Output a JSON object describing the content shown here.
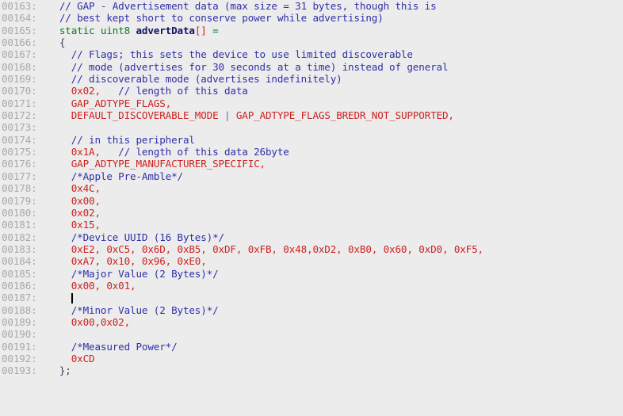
{
  "editor": {
    "name": "source-code-view",
    "language": "C",
    "background_color": "#ECECEC",
    "gutter_text_color": "#A9A9AD",
    "colors": {
      "comment": "#2F2FA8",
      "keyword": "#0A7A22",
      "identifier": "#13135E",
      "number": "#CC2222",
      "macro": "#CC2222",
      "punctuation": "#3A3A5A",
      "operator": "#0A7A22",
      "caret": "#000000"
    },
    "caret_line": "00187",
    "first_line": "00163",
    "last_line": "00193"
  },
  "lines": [
    {
      "no": "00163",
      "tokens": [
        {
          "c": "cmt",
          "t": "  // GAP - Advertisement data (max size = 31 bytes, though this is"
        }
      ]
    },
    {
      "no": "00164",
      "tokens": [
        {
          "c": "cmt",
          "t": "  // best kept short to conserve power while advertising)"
        }
      ]
    },
    {
      "no": "00165",
      "tokens": [
        {
          "c": "plain",
          "t": "  "
        },
        {
          "c": "kw",
          "t": "static uint8"
        },
        {
          "c": "plain",
          "t": " "
        },
        {
          "c": "id",
          "t": "advertData"
        },
        {
          "c": "num",
          "t": "[]"
        },
        {
          "c": "plain",
          "t": " "
        },
        {
          "c": "op",
          "t": "="
        }
      ]
    },
    {
      "no": "00166",
      "tokens": [
        {
          "c": "pun",
          "t": "  {"
        }
      ]
    },
    {
      "no": "00167",
      "tokens": [
        {
          "c": "cmt",
          "t": "    // Flags; this sets the device to use limited discoverable"
        }
      ]
    },
    {
      "no": "00168",
      "tokens": [
        {
          "c": "cmt",
          "t": "    // mode (advertises for 30 seconds at a time) instead of general"
        }
      ]
    },
    {
      "no": "00169",
      "tokens": [
        {
          "c": "cmt",
          "t": "    // discoverable mode (advertises indefinitely)"
        }
      ]
    },
    {
      "no": "00170",
      "tokens": [
        {
          "c": "num",
          "t": "    0x02,"
        },
        {
          "c": "cmt",
          "t": "   // length of this data"
        }
      ]
    },
    {
      "no": "00171",
      "tokens": [
        {
          "c": "mac",
          "t": "    GAP_ADTYPE_FLAGS,"
        }
      ]
    },
    {
      "no": "00172",
      "tokens": [
        {
          "c": "mac",
          "t": "    DEFAULT_DISCOVERABLE_MODE"
        },
        {
          "c": "plain",
          "t": " "
        },
        {
          "c": "pipe",
          "t": "|"
        },
        {
          "c": "plain",
          "t": " "
        },
        {
          "c": "mac",
          "t": "GAP_ADTYPE_FLAGS_BREDR_NOT_SUPPORTED,"
        }
      ]
    },
    {
      "no": "00173",
      "tokens": []
    },
    {
      "no": "00174",
      "tokens": [
        {
          "c": "cmt",
          "t": "    // in this peripheral"
        }
      ]
    },
    {
      "no": "00175",
      "tokens": [
        {
          "c": "num",
          "t": "    0x1A,"
        },
        {
          "c": "cmt",
          "t": "   // length of this data 26byte"
        }
      ]
    },
    {
      "no": "00176",
      "tokens": [
        {
          "c": "mac",
          "t": "    GAP_ADTYPE_MANUFACTURER_SPECIFIC,"
        }
      ]
    },
    {
      "no": "00177",
      "tokens": [
        {
          "c": "cmt",
          "t": "    /*Apple Pre-Amble*/"
        }
      ]
    },
    {
      "no": "00178",
      "tokens": [
        {
          "c": "num",
          "t": "    0x4C,"
        }
      ]
    },
    {
      "no": "00179",
      "tokens": [
        {
          "c": "num",
          "t": "    0x00,"
        }
      ]
    },
    {
      "no": "00180",
      "tokens": [
        {
          "c": "num",
          "t": "    0x02,"
        }
      ]
    },
    {
      "no": "00181",
      "tokens": [
        {
          "c": "num",
          "t": "    0x15,"
        }
      ]
    },
    {
      "no": "00182",
      "tokens": [
        {
          "c": "cmt",
          "t": "    /*Device UUID (16 Bytes)*/"
        }
      ]
    },
    {
      "no": "00183",
      "tokens": [
        {
          "c": "num",
          "t": "    0xE2, 0xC5, 0x6D, 0xB5, 0xDF, 0xFB, 0x48,0xD2, 0xB0, 0x60, 0xD0, 0xF5,"
        }
      ]
    },
    {
      "no": "00184",
      "tokens": [
        {
          "c": "num",
          "t": "    0xA7, 0x10, 0x96, 0xE0,"
        }
      ]
    },
    {
      "no": "00185",
      "tokens": [
        {
          "c": "cmt",
          "t": "    /*Major Value (2 Bytes)*/"
        }
      ]
    },
    {
      "no": "00186",
      "tokens": [
        {
          "c": "num",
          "t": "    0x00, 0x01,"
        }
      ]
    },
    {
      "no": "00187",
      "caret_after": 4,
      "tokens": [
        {
          "c": "plain",
          "t": "    "
        }
      ]
    },
    {
      "no": "00188",
      "tokens": [
        {
          "c": "cmt",
          "t": "    /*Minor Value (2 Bytes)*/"
        }
      ]
    },
    {
      "no": "00189",
      "tokens": [
        {
          "c": "num",
          "t": "    0x00,0x02,"
        }
      ]
    },
    {
      "no": "00190",
      "tokens": []
    },
    {
      "no": "00191",
      "tokens": [
        {
          "c": "cmt",
          "t": "    /*Measured Power*/"
        }
      ]
    },
    {
      "no": "00192",
      "tokens": [
        {
          "c": "num",
          "t": "    0xCD"
        }
      ]
    },
    {
      "no": "00193",
      "tokens": [
        {
          "c": "pun",
          "t": "  };"
        }
      ]
    }
  ]
}
